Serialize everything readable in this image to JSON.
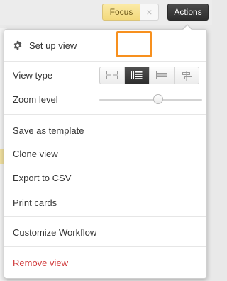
{
  "toolbar": {
    "focus_label": "Focus",
    "close_symbol": "×",
    "actions_label": "Actions"
  },
  "menu": {
    "setup_view": "Set up view",
    "view_type_label": "View type",
    "zoom_level_label": "Zoom level",
    "zoom_value_fraction": 0.6,
    "view_type_options": [
      "board-view",
      "card-list-view",
      "list-view",
      "timeline-view"
    ],
    "view_type_selected": "card-list-view",
    "save_as_template": "Save as template",
    "clone_view": "Clone view",
    "export_csv": "Export to CSV",
    "print_cards": "Print cards",
    "customize_workflow": "Customize Workflow",
    "remove_view": "Remove view"
  },
  "colors": {
    "focus_bg": "#f3d97c",
    "actions_bg": "#2d2d2d",
    "highlight_border": "#f7901e",
    "remove_text": "#d0393a"
  }
}
